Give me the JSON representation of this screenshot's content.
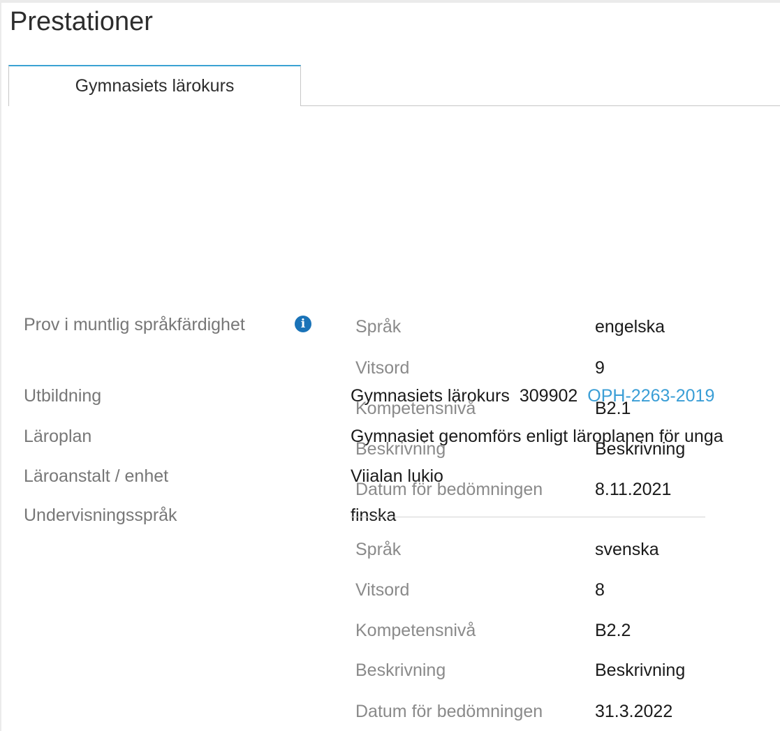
{
  "page": {
    "title": "Prestationer"
  },
  "tabs": [
    {
      "label": "Gymnasiets lärokurs",
      "active": true
    }
  ],
  "details": {
    "utbildning": {
      "label": "Utbildning",
      "name": "Gymnasiets lärokurs",
      "code": "309902",
      "link": "OPH-2263-2019"
    },
    "laroplan": {
      "label": "Läroplan",
      "value": "Gymnasiet genomförs enligt läroplanen för unga"
    },
    "laroanstalt": {
      "label": "Läroanstalt / enhet",
      "value": "Viialan lukio"
    },
    "undervisningssprak": {
      "label": "Undervisningsspråk",
      "value": "finska"
    },
    "prov": {
      "label": "Prov i muntlig språkfärdighet",
      "icon": "info-icon",
      "entries": [
        {
          "sprak_label": "Språk",
          "sprak": "engelska",
          "vitsord_label": "Vitsord",
          "vitsord": "9",
          "niva_label": "Kompetensnivå",
          "niva": "B2.1",
          "beskrivning_label": "Beskrivning",
          "beskrivning": "Beskrivning",
          "datum_label": "Datum för bedömningen",
          "datum": "8.11.2021"
        },
        {
          "sprak_label": "Språk",
          "sprak": "svenska",
          "vitsord_label": "Vitsord",
          "vitsord": "8",
          "niva_label": "Kompetensnivå",
          "niva": "B2.2",
          "beskrivning_label": "Beskrivning",
          "beskrivning": "Beskrivning",
          "datum_label": "Datum för bedömningen",
          "datum": "31.3.2022"
        }
      ]
    }
  },
  "colors": {
    "accent": "#3aa2d3",
    "link": "#3a9ed6",
    "label": "#777777",
    "info_icon": "#1a73b8"
  }
}
